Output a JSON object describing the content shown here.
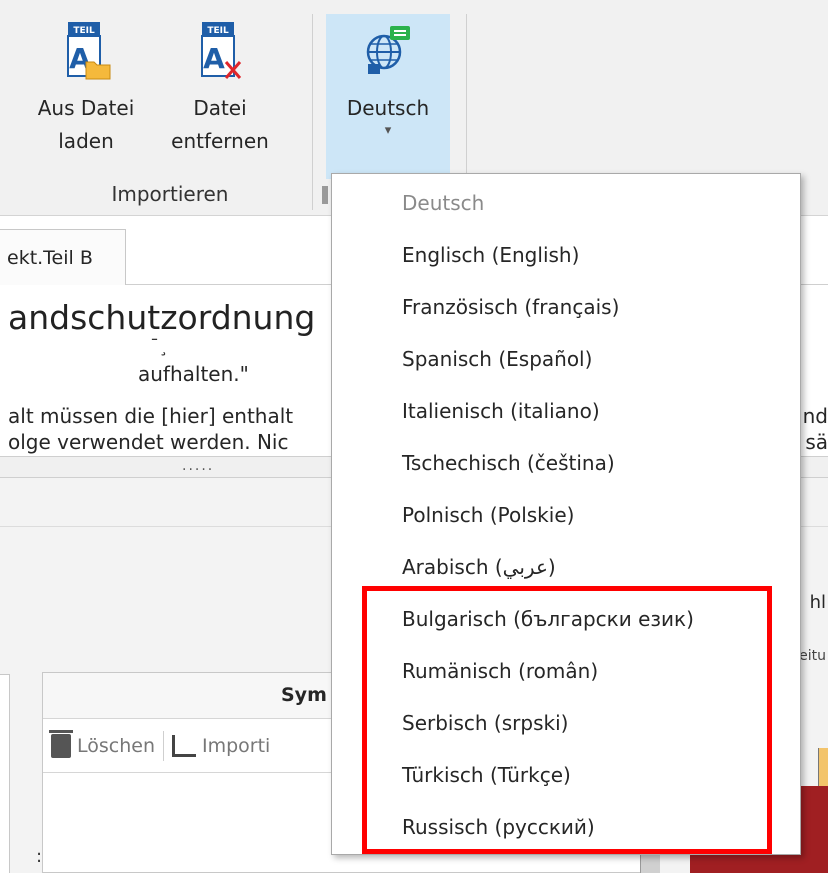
{
  "ribbon": {
    "buttons": {
      "aus_datei": {
        "line1": "Aus Datei",
        "line2": "laden",
        "icon": "teil-folder-icon"
      },
      "datei_entfernen": {
        "line1": "Datei",
        "line2": "entfernen",
        "icon": "teil-remove-icon"
      },
      "language": {
        "label": "Deutsch",
        "icon": "globe-language-icon"
      }
    },
    "icon_badge_text": "TEIL",
    "group_label": "Importieren"
  },
  "tabs": [
    {
      "label": "ekt.Teil B"
    }
  ],
  "document": {
    "heading": "andschutzordnung",
    "fragment": "¯¸",
    "quote_line": "aufhalten.\"",
    "line1": "alt müssen die [hier] enthalt",
    "line2": "olge verwendet werden. Nic",
    "right1": "nd",
    "right2": "sä"
  },
  "splitter": {
    "text": "....."
  },
  "symbol_panel": {
    "header": "Sym",
    "toolbar": {
      "delete_label": "Löschen",
      "import_label": "Importi"
    }
  },
  "lower": {
    "colon": ":",
    "right_text1": "hl",
    "right_text2": "eitu"
  },
  "language_menu": {
    "items": [
      {
        "label": "Deutsch",
        "disabled": true
      },
      {
        "label": "Englisch (English)"
      },
      {
        "label": "Französisch (français)"
      },
      {
        "label": "Spanisch (Español)"
      },
      {
        "label": "Italienisch (italiano)"
      },
      {
        "label": "Tschechisch (čeština)"
      },
      {
        "label": "Polnisch (Polskie)"
      },
      {
        "label": "Arabisch (عربي)"
      },
      {
        "label": "Bulgarisch (български език)"
      },
      {
        "label": "Rumänisch (român)"
      },
      {
        "label": "Serbisch (srpski)"
      },
      {
        "label": "Türkisch (Türkçe)"
      },
      {
        "label": "Russisch (русский)"
      }
    ]
  },
  "colors": {
    "ribbon_bg": "#f1f1f1",
    "selected_button": "#cde6f7",
    "highlight_border": "#ff0000",
    "icon_blue": "#1f5ea8",
    "folder_yellow": "#f5b93c",
    "remove_red": "#e0262b",
    "globe_green": "#2bb24c"
  }
}
